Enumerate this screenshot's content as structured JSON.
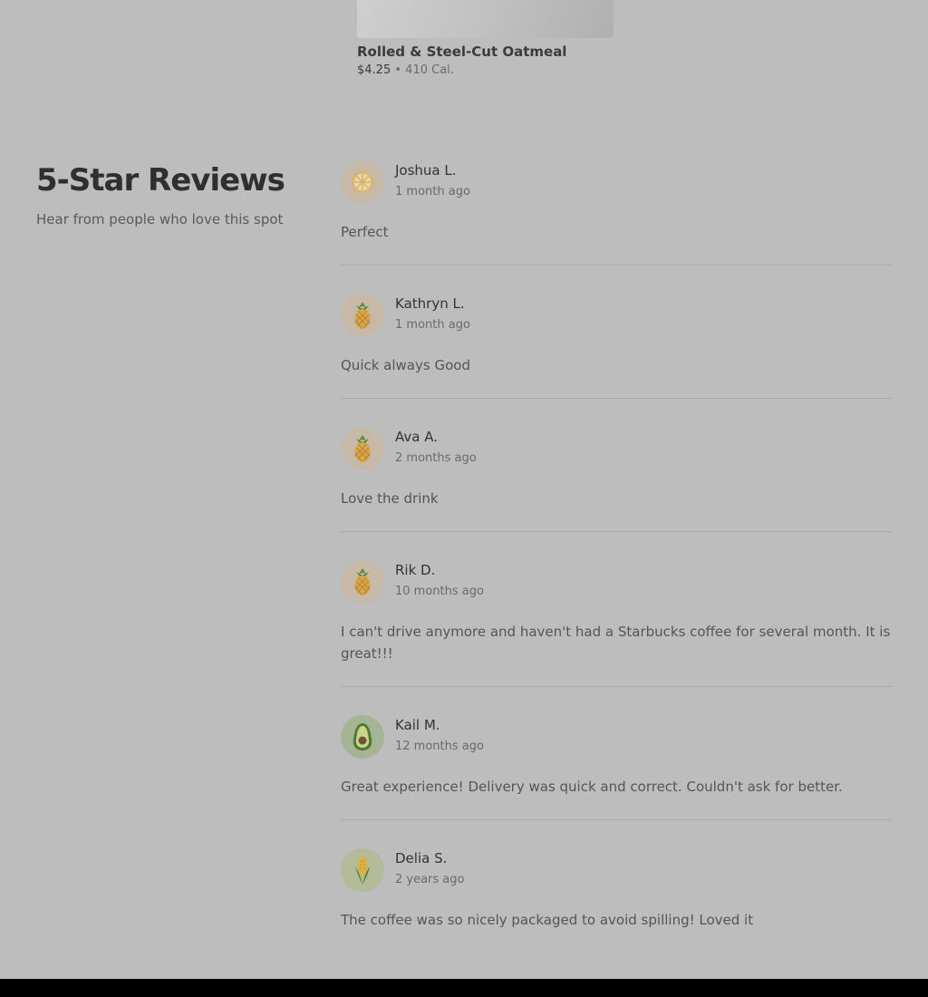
{
  "product": {
    "name": "Rolled & Steel-Cut Oatmeal",
    "price": "$4.25",
    "separator": "•",
    "calories": "410 Cal."
  },
  "reviews_section": {
    "title": "5-Star Reviews",
    "subtitle": "Hear from people who love this spot"
  },
  "reviews": [
    {
      "name": "Joshua L.",
      "date": "1 month ago",
      "text": "Perfect",
      "avatar_icon": "orange-slice-icon"
    },
    {
      "name": "Kathryn L.",
      "date": "1 month ago",
      "text": "Quick always Good",
      "avatar_icon": "pineapple-icon"
    },
    {
      "name": "Ava A.",
      "date": "2 months ago",
      "text": "Love the drink",
      "avatar_icon": "pineapple-icon"
    },
    {
      "name": "Rik D.",
      "date": "10 months ago",
      "text": "I can't drive anymore and haven't had a Starbucks coffee for several month. It is great!!!",
      "avatar_icon": "pineapple-icon"
    },
    {
      "name": "Kail M.",
      "date": "12 months ago",
      "text": "Great experience! Delivery was quick and correct. Couldn't ask for better.",
      "avatar_icon": "avocado-icon"
    },
    {
      "name": "Delia S.",
      "date": "2 years ago",
      "text": "The coffee was so nicely packaged to avoid spilling! Loved it",
      "avatar_icon": "corn-icon"
    }
  ],
  "colors": {
    "overlay_background": "#bdbdbd",
    "bottom_bar": "#000000"
  }
}
